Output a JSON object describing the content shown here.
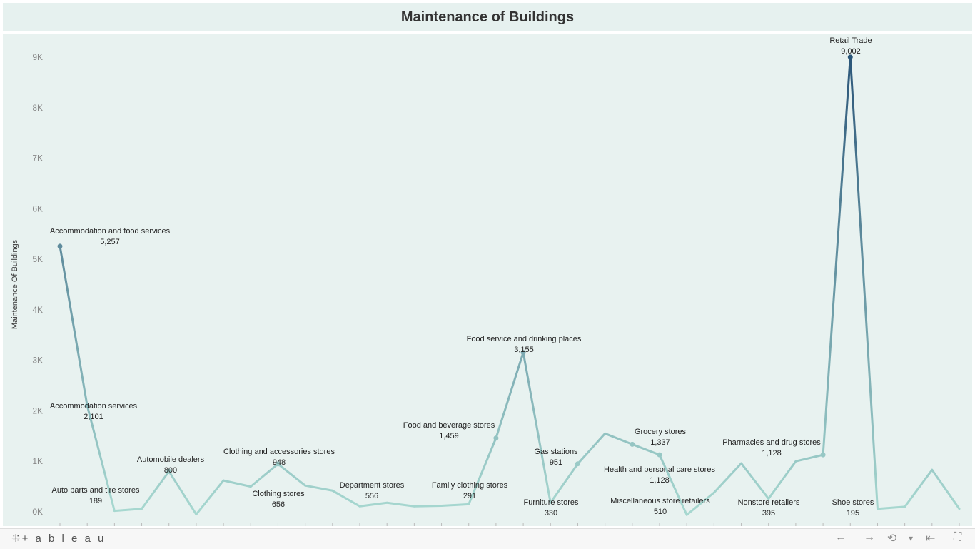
{
  "title": "Maintenance of Buildings",
  "brand": "+ a b l e a u",
  "brand_icon": "tableau-logo-icon",
  "footer_controls": [
    {
      "name": "undo-icon",
      "glyph": "←"
    },
    {
      "name": "redo-icon",
      "glyph": "→"
    },
    {
      "name": "revert-icon",
      "glyph": "⟲"
    },
    {
      "name": "dropdown-icon",
      "glyph": "▾"
    },
    {
      "name": "reset-icon",
      "glyph": "⇤"
    },
    {
      "name": "fullscreen-icon",
      "glyph": "⛶"
    }
  ],
  "colors": {
    "low": "#a7d8d0",
    "high": "#2b5679",
    "background": "#e8f2f0"
  },
  "chart_data": {
    "type": "line",
    "title": "Maintenance of Buildings",
    "ylabel": "Maintenance Of Buildings",
    "ylim": [
      0,
      9000
    ],
    "yticks": [
      "0K",
      "1K",
      "2K",
      "3K",
      "4K",
      "5K",
      "6K",
      "7K",
      "8K",
      "9K"
    ],
    "grid": false,
    "points": [
      {
        "label": "Accommodation and food services",
        "value": 5257,
        "show": true,
        "text": "5,257"
      },
      {
        "label": "Accommodation services",
        "value": 2101,
        "show": true,
        "text": "2,101"
      },
      {
        "label": "",
        "value": 20,
        "show": false
      },
      {
        "label": "",
        "value": 60,
        "show": false
      },
      {
        "label": "Automobile dealers",
        "value": 800,
        "show": true,
        "text": "800"
      },
      {
        "label": "",
        "value": -50,
        "show": false
      },
      {
        "label": "",
        "value": 620,
        "show": false
      },
      {
        "label": "",
        "value": 500,
        "show": false
      },
      {
        "label": "Clothing and accessories stores",
        "value": 948,
        "show": true,
        "text": "948"
      },
      {
        "label": "",
        "value": 520,
        "show": false
      },
      {
        "label": "",
        "value": 420,
        "show": false
      },
      {
        "label": "",
        "value": 110,
        "show": false
      },
      {
        "label": "",
        "value": 180,
        "show": false
      },
      {
        "label": "",
        "value": 110,
        "show": false
      },
      {
        "label": "",
        "value": 120,
        "show": false
      },
      {
        "label": "",
        "value": 150,
        "show": false
      },
      {
        "label": "Food and beverage stores",
        "value": 1459,
        "show": true,
        "text": "1,459"
      },
      {
        "label": "Food service and drinking places",
        "value": 3155,
        "show": true,
        "text": "3,155"
      },
      {
        "label": "",
        "value": 180,
        "show": false
      },
      {
        "label": "Gas stations",
        "value": 951,
        "show": true,
        "text": "951"
      },
      {
        "label": "",
        "value": 1550,
        "show": false
      },
      {
        "label": "Grocery stores",
        "value": 1337,
        "show": true,
        "text": "1,337"
      },
      {
        "label": "Health and personal care stores",
        "value": 1128,
        "show": true,
        "text": "1,128"
      },
      {
        "label": "",
        "value": -60,
        "show": false
      },
      {
        "label": "",
        "value": 380,
        "show": false
      },
      {
        "label": "",
        "value": 960,
        "show": false
      },
      {
        "label": "",
        "value": 260,
        "show": false
      },
      {
        "label": "",
        "value": 1000,
        "show": false
      },
      {
        "label": "Pharmacies and drug stores",
        "value": 1128,
        "show": true,
        "text": "1,128"
      },
      {
        "label": "Retail Trade",
        "value": 9002,
        "show": true,
        "text": "9,002"
      },
      {
        "label": "",
        "value": 60,
        "show": false
      },
      {
        "label": "",
        "value": 100,
        "show": false
      },
      {
        "label": "",
        "value": 830,
        "show": false
      },
      {
        "label": "",
        "value": 60,
        "show": false
      }
    ],
    "annotations": [
      {
        "label": "Accommodation and food services",
        "text": "5,257"
      },
      {
        "label": "Accommodation services",
        "text": "2,101"
      },
      {
        "label": "Auto parts and tire stores",
        "text": "189"
      },
      {
        "label": "Automobile dealers",
        "text": "800"
      },
      {
        "label": "Clothing and accessories stores",
        "text": "948"
      },
      {
        "label": "Clothing stores",
        "text": "656"
      },
      {
        "label": "Department stores",
        "text": "556"
      },
      {
        "label": "Family clothing stores",
        "text": "291"
      },
      {
        "label": "Food and beverage stores",
        "text": "1,459"
      },
      {
        "label": "Food service and drinking places",
        "text": "3,155"
      },
      {
        "label": "Gas stations",
        "text": "951"
      },
      {
        "label": "Furniture stores",
        "text": "330"
      },
      {
        "label": "Grocery stores",
        "text": "1,337"
      },
      {
        "label": "Health and personal care stores",
        "text": "1,128"
      },
      {
        "label": "Miscellaneous store retailers",
        "text": "510"
      },
      {
        "label": "Pharmacies and drug stores",
        "text": "1,128"
      },
      {
        "label": "Nonstore retailers",
        "text": "395"
      },
      {
        "label": "Retail Trade",
        "text": "9,002"
      },
      {
        "label": "Shoe stores",
        "text": "195"
      }
    ]
  }
}
